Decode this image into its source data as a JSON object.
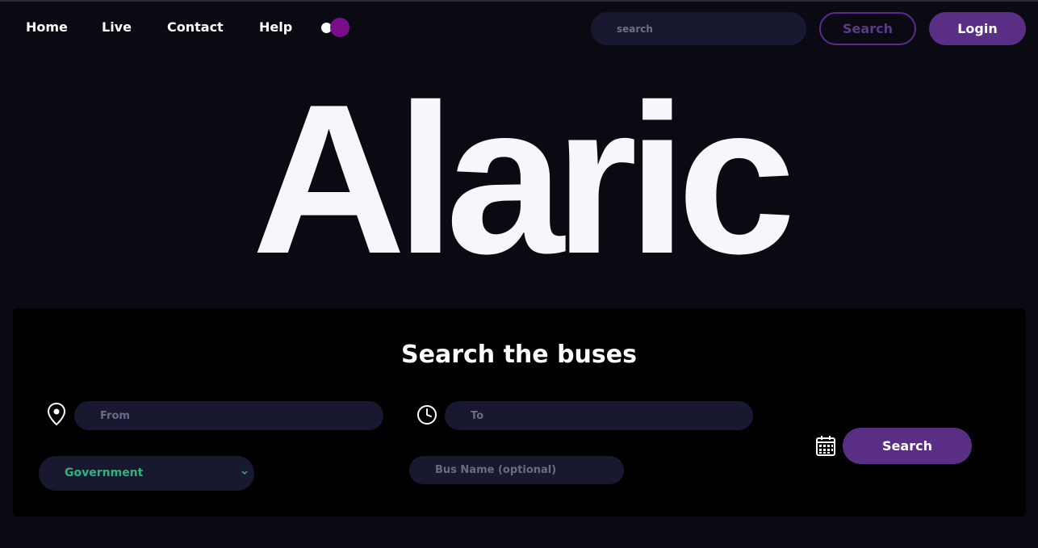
{
  "nav": {
    "links": [
      "Home",
      "Live",
      "Contact",
      "Help"
    ],
    "search_placeholder": "search",
    "search_button": "Search",
    "login_button": "Login"
  },
  "hero": {
    "title": "Alaric"
  },
  "search_panel": {
    "title": "Search the buses",
    "from_placeholder": "From",
    "to_placeholder": "To",
    "bus_type_selected": "Government",
    "bus_name_placeholder": "Bus Name (optional)",
    "search_button": "Search"
  },
  "colors": {
    "background": "#0a0a12",
    "panel": "#000000",
    "accent_purple": "#5b2e86",
    "toggle_purple": "#7a0d8c",
    "input_bg": "#181830",
    "select_text": "#2fb37f"
  },
  "icons": [
    "location-pin-icon",
    "clock-icon",
    "calendar-icon",
    "chevron-down-icon"
  ]
}
